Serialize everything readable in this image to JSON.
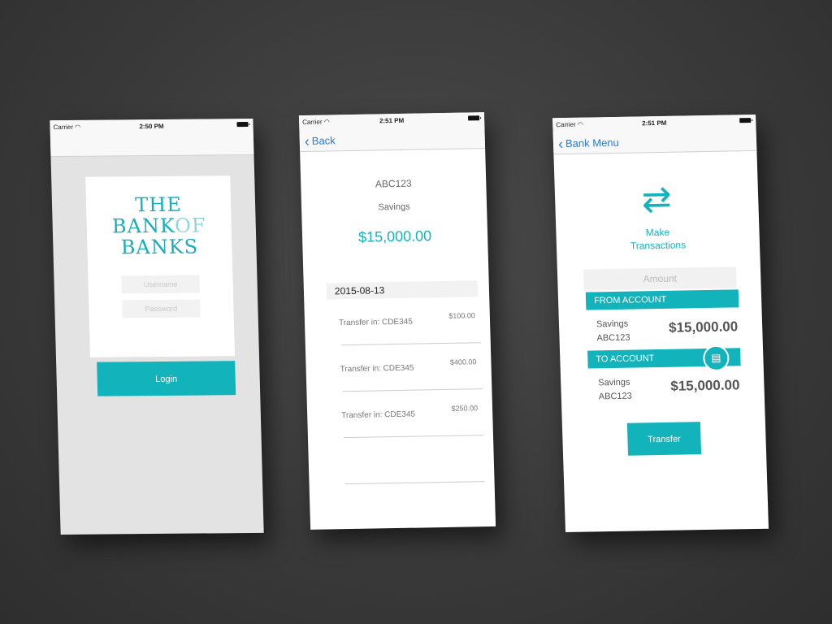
{
  "login_screen": {
    "status": {
      "carrier": "Carrier",
      "time": "2:50 PM"
    },
    "logo": {
      "line1": "THE",
      "line2_bank": "BANK",
      "line2_of": "OF",
      "line3": "BANKS"
    },
    "username_placeholder": "Username",
    "password_placeholder": "Password",
    "login_label": "Login"
  },
  "account_screen": {
    "status": {
      "carrier": "Carrier",
      "time": "2:51 PM"
    },
    "back_label": "Back",
    "account_id": "ABC123",
    "account_type": "Savings",
    "balance": "$15,000.00",
    "date": "2015-08-13",
    "transactions": [
      {
        "desc": "Transfer in: CDE345",
        "amount": "$100.00"
      },
      {
        "desc": "Transfer in: CDE345",
        "amount": "$400.00"
      },
      {
        "desc": "Transfer in: CDE345",
        "amount": "$250.00"
      }
    ]
  },
  "transfer_screen": {
    "status": {
      "carrier": "Carrier",
      "time": "2:51 PM"
    },
    "back_label": "Bank Menu",
    "title_line1": "Make",
    "title_line2": "Transactions",
    "amount_placeholder": "Amount",
    "from_label": "FROM ACCOUNT",
    "from": {
      "type": "Savings",
      "id": "ABC123",
      "balance": "$15,000.00"
    },
    "to_label": "TO ACCOUNT",
    "to": {
      "type": "Savings",
      "id": "ABC123",
      "balance": "$15,000.00"
    },
    "transfer_label": "Transfer"
  },
  "colors": {
    "accent": "#13b3bc",
    "link": "#2b7be0"
  },
  "icons": [
    "wifi-icon",
    "battery-icon",
    "back-chevron-icon",
    "swap-arrows-icon",
    "contacts-icon"
  ]
}
